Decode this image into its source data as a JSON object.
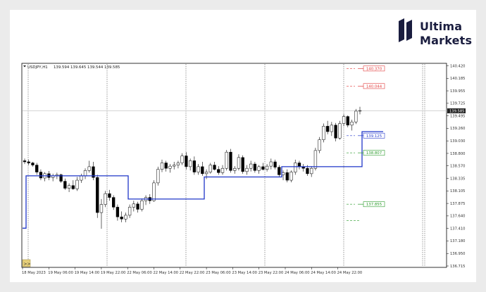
{
  "brand": {
    "line1": "Ultima",
    "line2": "Markets"
  },
  "header": {
    "symbol": "USDJPY,H1",
    "ohlc": "139.594 139.645 139.544 139.585"
  },
  "chart_data": {
    "type": "candlestick",
    "symbol": "USDJPY",
    "timeframe": "H1",
    "ylim": [
      136.71,
      140.42
    ],
    "y_ticks": [
      "140.420",
      "140.185",
      "139.955",
      "139.725",
      "139.495",
      "139.260",
      "139.030",
      "138.800",
      "138.570",
      "138.335",
      "138.105",
      "137.875",
      "137.640",
      "137.410",
      "137.180",
      "136.950",
      "136.715"
    ],
    "x_ticks": [
      "18 May 2023",
      "19 May 06:00",
      "19 May 14:00",
      "19 May 22:00",
      "22 May 06:00",
      "22 May 14:00",
      "22 May 22:00",
      "23 May 06:00",
      "23 May 14:00",
      "23 May 22:00",
      "24 May 06:00",
      "24 May 14:00",
      "24 May 22:00"
    ],
    "current_price": "139.585",
    "candles": [
      [
        138.66,
        138.7,
        138.6,
        138.64
      ],
      [
        138.64,
        138.68,
        138.58,
        138.62
      ],
      [
        138.62,
        138.64,
        138.55,
        138.58
      ],
      [
        138.58,
        138.62,
        138.4,
        138.45
      ],
      [
        138.45,
        138.5,
        138.3,
        138.34
      ],
      [
        138.34,
        138.45,
        138.28,
        138.42
      ],
      [
        138.42,
        138.47,
        138.3,
        138.35
      ],
      [
        138.35,
        138.42,
        138.28,
        138.38
      ],
      [
        138.38,
        138.44,
        138.32,
        138.4
      ],
      [
        138.4,
        138.42,
        138.25,
        138.28
      ],
      [
        138.28,
        138.33,
        138.12,
        138.15
      ],
      [
        138.15,
        138.24,
        138.08,
        138.2
      ],
      [
        138.2,
        138.3,
        138.12,
        138.14
      ],
      [
        138.14,
        138.36,
        138.1,
        138.3
      ],
      [
        138.3,
        138.42,
        138.25,
        138.38
      ],
      [
        138.38,
        138.52,
        138.32,
        138.48
      ],
      [
        138.48,
        138.66,
        138.44,
        138.55
      ],
      [
        138.55,
        138.64,
        138.3,
        138.35
      ],
      [
        138.35,
        138.4,
        137.6,
        137.7
      ],
      [
        137.7,
        137.95,
        137.4,
        137.85
      ],
      [
        137.85,
        138.1,
        137.8,
        138.05
      ],
      [
        138.05,
        138.12,
        137.92,
        137.98
      ],
      [
        137.98,
        138.02,
        137.75,
        137.8
      ],
      [
        137.8,
        137.85,
        137.55,
        137.62
      ],
      [
        137.62,
        137.72,
        137.52,
        137.58
      ],
      [
        137.58,
        137.7,
        137.52,
        137.65
      ],
      [
        137.65,
        137.85,
        137.6,
        137.8
      ],
      [
        137.8,
        137.92,
        137.72,
        137.86
      ],
      [
        137.86,
        137.9,
        137.7,
        137.76
      ],
      [
        137.76,
        137.96,
        137.72,
        137.92
      ],
      [
        137.92,
        138.02,
        137.84,
        137.98
      ],
      [
        137.98,
        138.04,
        137.86,
        137.92
      ],
      [
        137.92,
        138.3,
        137.9,
        138.25
      ],
      [
        138.25,
        138.55,
        138.2,
        138.5
      ],
      [
        138.5,
        138.68,
        138.45,
        138.62
      ],
      [
        138.62,
        138.66,
        138.46,
        138.52
      ],
      [
        138.52,
        138.6,
        138.44,
        138.56
      ],
      [
        138.56,
        138.64,
        138.5,
        138.58
      ],
      [
        138.58,
        138.66,
        138.52,
        138.62
      ],
      [
        138.62,
        138.8,
        138.58,
        138.75
      ],
      [
        138.75,
        138.82,
        138.5,
        138.55
      ],
      [
        138.55,
        138.7,
        138.48,
        138.66
      ],
      [
        138.66,
        138.74,
        138.4,
        138.45
      ],
      [
        138.45,
        138.6,
        138.4,
        138.55
      ],
      [
        138.55,
        138.64,
        138.38,
        138.42
      ],
      [
        138.42,
        138.5,
        138.32,
        138.45
      ],
      [
        138.45,
        138.62,
        138.42,
        138.58
      ],
      [
        138.58,
        138.64,
        138.48,
        138.5
      ],
      [
        138.5,
        138.56,
        138.4,
        138.44
      ],
      [
        138.44,
        138.58,
        138.4,
        138.52
      ],
      [
        138.52,
        138.86,
        138.48,
        138.82
      ],
      [
        138.82,
        138.88,
        138.44,
        138.48
      ],
      [
        138.48,
        138.56,
        138.42,
        138.52
      ],
      [
        138.52,
        138.78,
        138.48,
        138.72
      ],
      [
        138.72,
        138.76,
        138.42,
        138.46
      ],
      [
        138.46,
        138.58,
        138.4,
        138.52
      ],
      [
        138.52,
        138.66,
        138.46,
        138.6
      ],
      [
        138.6,
        138.64,
        138.44,
        138.48
      ],
      [
        138.48,
        138.58,
        138.42,
        138.55
      ],
      [
        138.55,
        138.62,
        138.48,
        138.5
      ],
      [
        138.5,
        138.6,
        138.46,
        138.56
      ],
      [
        138.56,
        138.7,
        138.5,
        138.64
      ],
      [
        138.64,
        138.68,
        138.5,
        138.54
      ],
      [
        138.54,
        138.58,
        138.36,
        138.4
      ],
      [
        138.4,
        138.48,
        138.3,
        138.44
      ],
      [
        138.44,
        138.5,
        138.26,
        138.3
      ],
      [
        138.3,
        138.48,
        138.26,
        138.45
      ],
      [
        138.45,
        138.68,
        138.4,
        138.62
      ],
      [
        138.62,
        138.66,
        138.5,
        138.55
      ],
      [
        138.55,
        138.6,
        138.46,
        138.52
      ],
      [
        138.52,
        138.58,
        138.38,
        138.42
      ],
      [
        138.42,
        138.56,
        138.36,
        138.52
      ],
      [
        138.52,
        138.9,
        138.48,
        138.85
      ],
      [
        138.85,
        139.1,
        138.8,
        139.05
      ],
      [
        139.05,
        139.35,
        139.0,
        139.3
      ],
      [
        139.3,
        139.4,
        139.15,
        139.2
      ],
      [
        139.2,
        139.38,
        139.12,
        139.32
      ],
      [
        139.32,
        139.36,
        139.02,
        139.08
      ],
      [
        139.08,
        139.4,
        139.05,
        139.35
      ],
      [
        139.35,
        139.52,
        139.3,
        139.48
      ],
      [
        139.48,
        139.5,
        139.28,
        139.32
      ],
      [
        139.32,
        139.42,
        139.22,
        139.38
      ],
      [
        139.38,
        139.62,
        139.34,
        139.58
      ],
      [
        139.58,
        139.66,
        139.52,
        139.59
      ]
    ],
    "series": [
      {
        "name": "",
        "color": "#1f36c8",
        "levels": [
          [
            0,
            5,
            137.41
          ],
          [
            5,
            150,
            138.38
          ],
          [
            150,
            258,
            137.95
          ],
          [
            258,
            368,
            138.36
          ],
          [
            368,
            482,
            138.55
          ],
          [
            482,
            512,
            139.2
          ]
        ]
      }
    ],
    "price_labels": [
      {
        "text": "140.370",
        "color": "#e23c3c",
        "price": 140.37
      },
      {
        "text": "140.044",
        "color": "#e23c3c",
        "price": 140.044
      },
      {
        "text": "139.125",
        "color": "#2a3ecc",
        "price": 139.125
      },
      {
        "text": "138.807",
        "color": "#2a9a2a",
        "price": 138.807
      },
      {
        "text": "137.855",
        "color": "#2a9a2a",
        "price": 137.855
      }
    ],
    "extra_dashes": [
      {
        "color": "#2a9a2a",
        "price": 137.55
      }
    ],
    "grid": false
  }
}
